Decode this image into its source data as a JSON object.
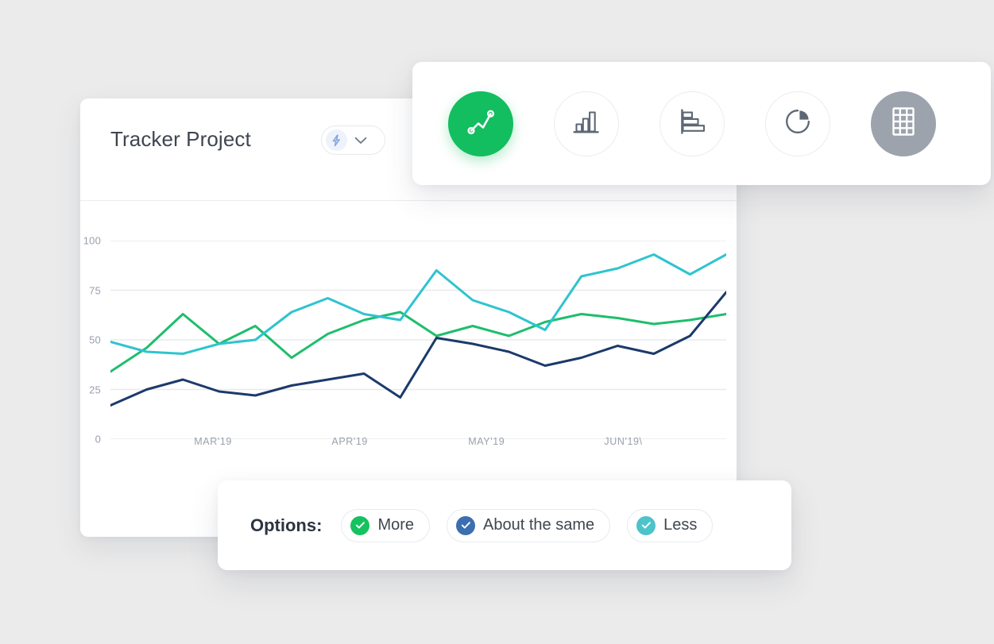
{
  "card": {
    "title": "Tracker Project",
    "selector": {
      "icon": "lightning-bolt-icon",
      "chevron": "chevron-down-icon"
    }
  },
  "toolbar": {
    "buttons": [
      {
        "id": "line-chart",
        "icon": "line-chart-icon",
        "state": "active",
        "accent": "#12be5f"
      },
      {
        "id": "bar-chart",
        "icon": "bar-chart-icon",
        "state": "default",
        "accent": "#5d6775"
      },
      {
        "id": "horizontal-bar-chart",
        "icon": "horizontal-bar-chart-icon",
        "state": "default",
        "accent": "#5d6775"
      },
      {
        "id": "pie-chart",
        "icon": "pie-chart-icon",
        "state": "default",
        "accent": "#5d6775"
      },
      {
        "id": "table-view",
        "icon": "table-grid-icon",
        "state": "active",
        "accent": "#9ca3ad"
      }
    ]
  },
  "options": {
    "label": "Options:",
    "chips": [
      {
        "label": "More",
        "color": "#15c25f"
      },
      {
        "label": "About the same",
        "color": "#3c6fb0"
      },
      {
        "label": "Less",
        "color": "#4ec3c9"
      }
    ]
  },
  "chart_data": {
    "type": "line",
    "title": "Tracker Project",
    "xlabel": "",
    "ylabel": "",
    "ylim": [
      0,
      100
    ],
    "yticks": [
      0,
      25,
      50,
      75,
      100
    ],
    "ytick_labels": [
      "0",
      "25",
      "50",
      "75",
      "100"
    ],
    "grid": true,
    "legend": "none",
    "x_tick_positions": [
      3,
      7,
      11,
      15
    ],
    "x_tick_labels": [
      "MAR'19",
      "APR'19",
      "MAY'19",
      "JUN'19\\"
    ],
    "x": [
      0,
      1,
      2,
      3,
      4,
      5,
      6,
      7,
      8,
      9,
      10,
      11,
      12,
      13,
      14,
      15,
      16,
      17
    ],
    "series": [
      {
        "name": "More",
        "color": "#1ebe6d",
        "values": [
          34,
          46,
          63,
          48,
          57,
          41,
          53,
          60,
          64,
          52,
          57,
          52,
          59,
          63,
          61,
          58,
          60,
          63
        ]
      },
      {
        "name": "Less",
        "color": "#2ec4cf",
        "values": [
          49,
          44,
          43,
          48,
          50,
          64,
          71,
          63,
          60,
          85,
          70,
          64,
          55,
          82,
          86,
          93,
          83,
          93
        ]
      },
      {
        "name": "About the same",
        "color": "#1b3a6b",
        "values": [
          17,
          25,
          30,
          24,
          22,
          27,
          30,
          33,
          21,
          51,
          48,
          44,
          37,
          41,
          47,
          43,
          52,
          74
        ]
      }
    ]
  }
}
